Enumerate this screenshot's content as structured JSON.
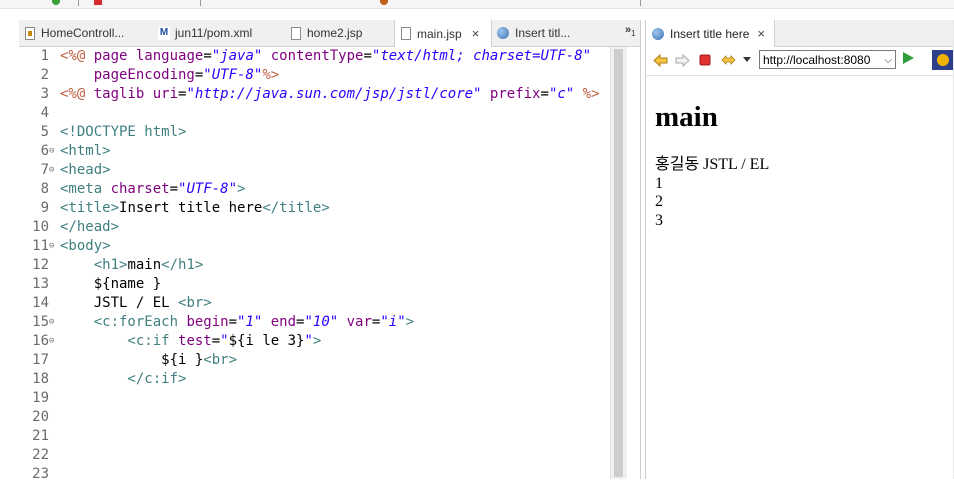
{
  "editor": {
    "tabs": [
      {
        "label": "HomeControll...",
        "icon": "java-file-icon"
      },
      {
        "label": "jun11/pom.xml",
        "icon": "maven-icon"
      },
      {
        "label": "home2.jsp",
        "icon": "jsp-file-icon"
      },
      {
        "label": "main.jsp",
        "icon": "jsp-file-icon",
        "active": true
      },
      {
        "label": "Insert titl...",
        "icon": "globe-icon"
      }
    ],
    "overflow": "»",
    "overflow_count": "1",
    "close_glyph": "×",
    "line_numbers": [
      "1",
      "2",
      "3",
      "4",
      "5",
      "6",
      "7",
      "8",
      "9",
      "10",
      "11",
      "12",
      "13",
      "14",
      "15",
      "16",
      "17",
      "18",
      "19",
      "20",
      "21",
      "22",
      "23"
    ],
    "fold_marker": "⊖",
    "code": {
      "l1": {
        "a": "<%@ ",
        "b": "page ",
        "c": "language",
        "d": "=",
        "e": "\"java\"",
        "f": " contentType",
        "g": "=",
        "h": "\"text/html; charset=UTF-8\""
      },
      "l2": {
        "a": "    pageEncoding",
        "b": "=",
        "c": "\"UTF-8\"",
        "d": "%>"
      },
      "l3": {
        "a": "<%@ ",
        "b": "taglib ",
        "c": "uri",
        "d": "=",
        "e": "\"http://java.sun.com/jsp/jstl/core\"",
        "f": " prefix",
        "g": "=",
        "h": "\"c\"",
        "i": " %>"
      },
      "l5": "<!DOCTYPE html>",
      "l6": "<html>",
      "l7": "<head>",
      "l8": {
        "a": "<meta ",
        "b": "charset",
        "c": "=",
        "d": "\"UTF-8\"",
        "e": ">"
      },
      "l9": {
        "a": "<title>",
        "b": "Insert title here",
        "c": "</title>"
      },
      "l10": "</head>",
      "l11": "<body>",
      "l12": {
        "a": "    <h1>",
        "b": "main",
        "c": "</h1>"
      },
      "l13": "    ${name }",
      "l14": {
        "a": "    JSTL / EL ",
        "b": "<br>"
      },
      "l15": {
        "a": "    <c:forEach ",
        "b": "begin",
        "c": "=",
        "d": "\"1\"",
        "e": " end",
        "f": "=",
        "g": "\"10\"",
        "h": " var",
        "i": "=",
        "j": "\"i\"",
        "k": ">"
      },
      "l16": {
        "a": "        <c:if ",
        "b": "test",
        "c": "=",
        "d": "\"",
        "e": "${i le 3}",
        "f": "\"",
        "g": ">"
      },
      "l17": {
        "a": "            ${i }",
        "b": "<br>"
      },
      "l18": "        </c:if>"
    }
  },
  "browser": {
    "tab_label": "Insert title here",
    "close_glyph": "×",
    "url": "http://localhost:8080",
    "url_caret": "⌵",
    "toolbar_icons": [
      "back-arrow-icon",
      "forward-arrow-icon",
      "stop-icon",
      "refresh-icon",
      "dropdown-icon",
      "go-icon",
      "eclipse-icon"
    ],
    "page": {
      "heading": "main",
      "line1": "홍길동 JSTL / EL",
      "items": [
        "1",
        "2",
        "3"
      ]
    }
  },
  "colors": {
    "tag": "#3f7f7f",
    "attr": "#7f007f",
    "string": "#2a00ff",
    "directive": "#bf5f3f"
  }
}
